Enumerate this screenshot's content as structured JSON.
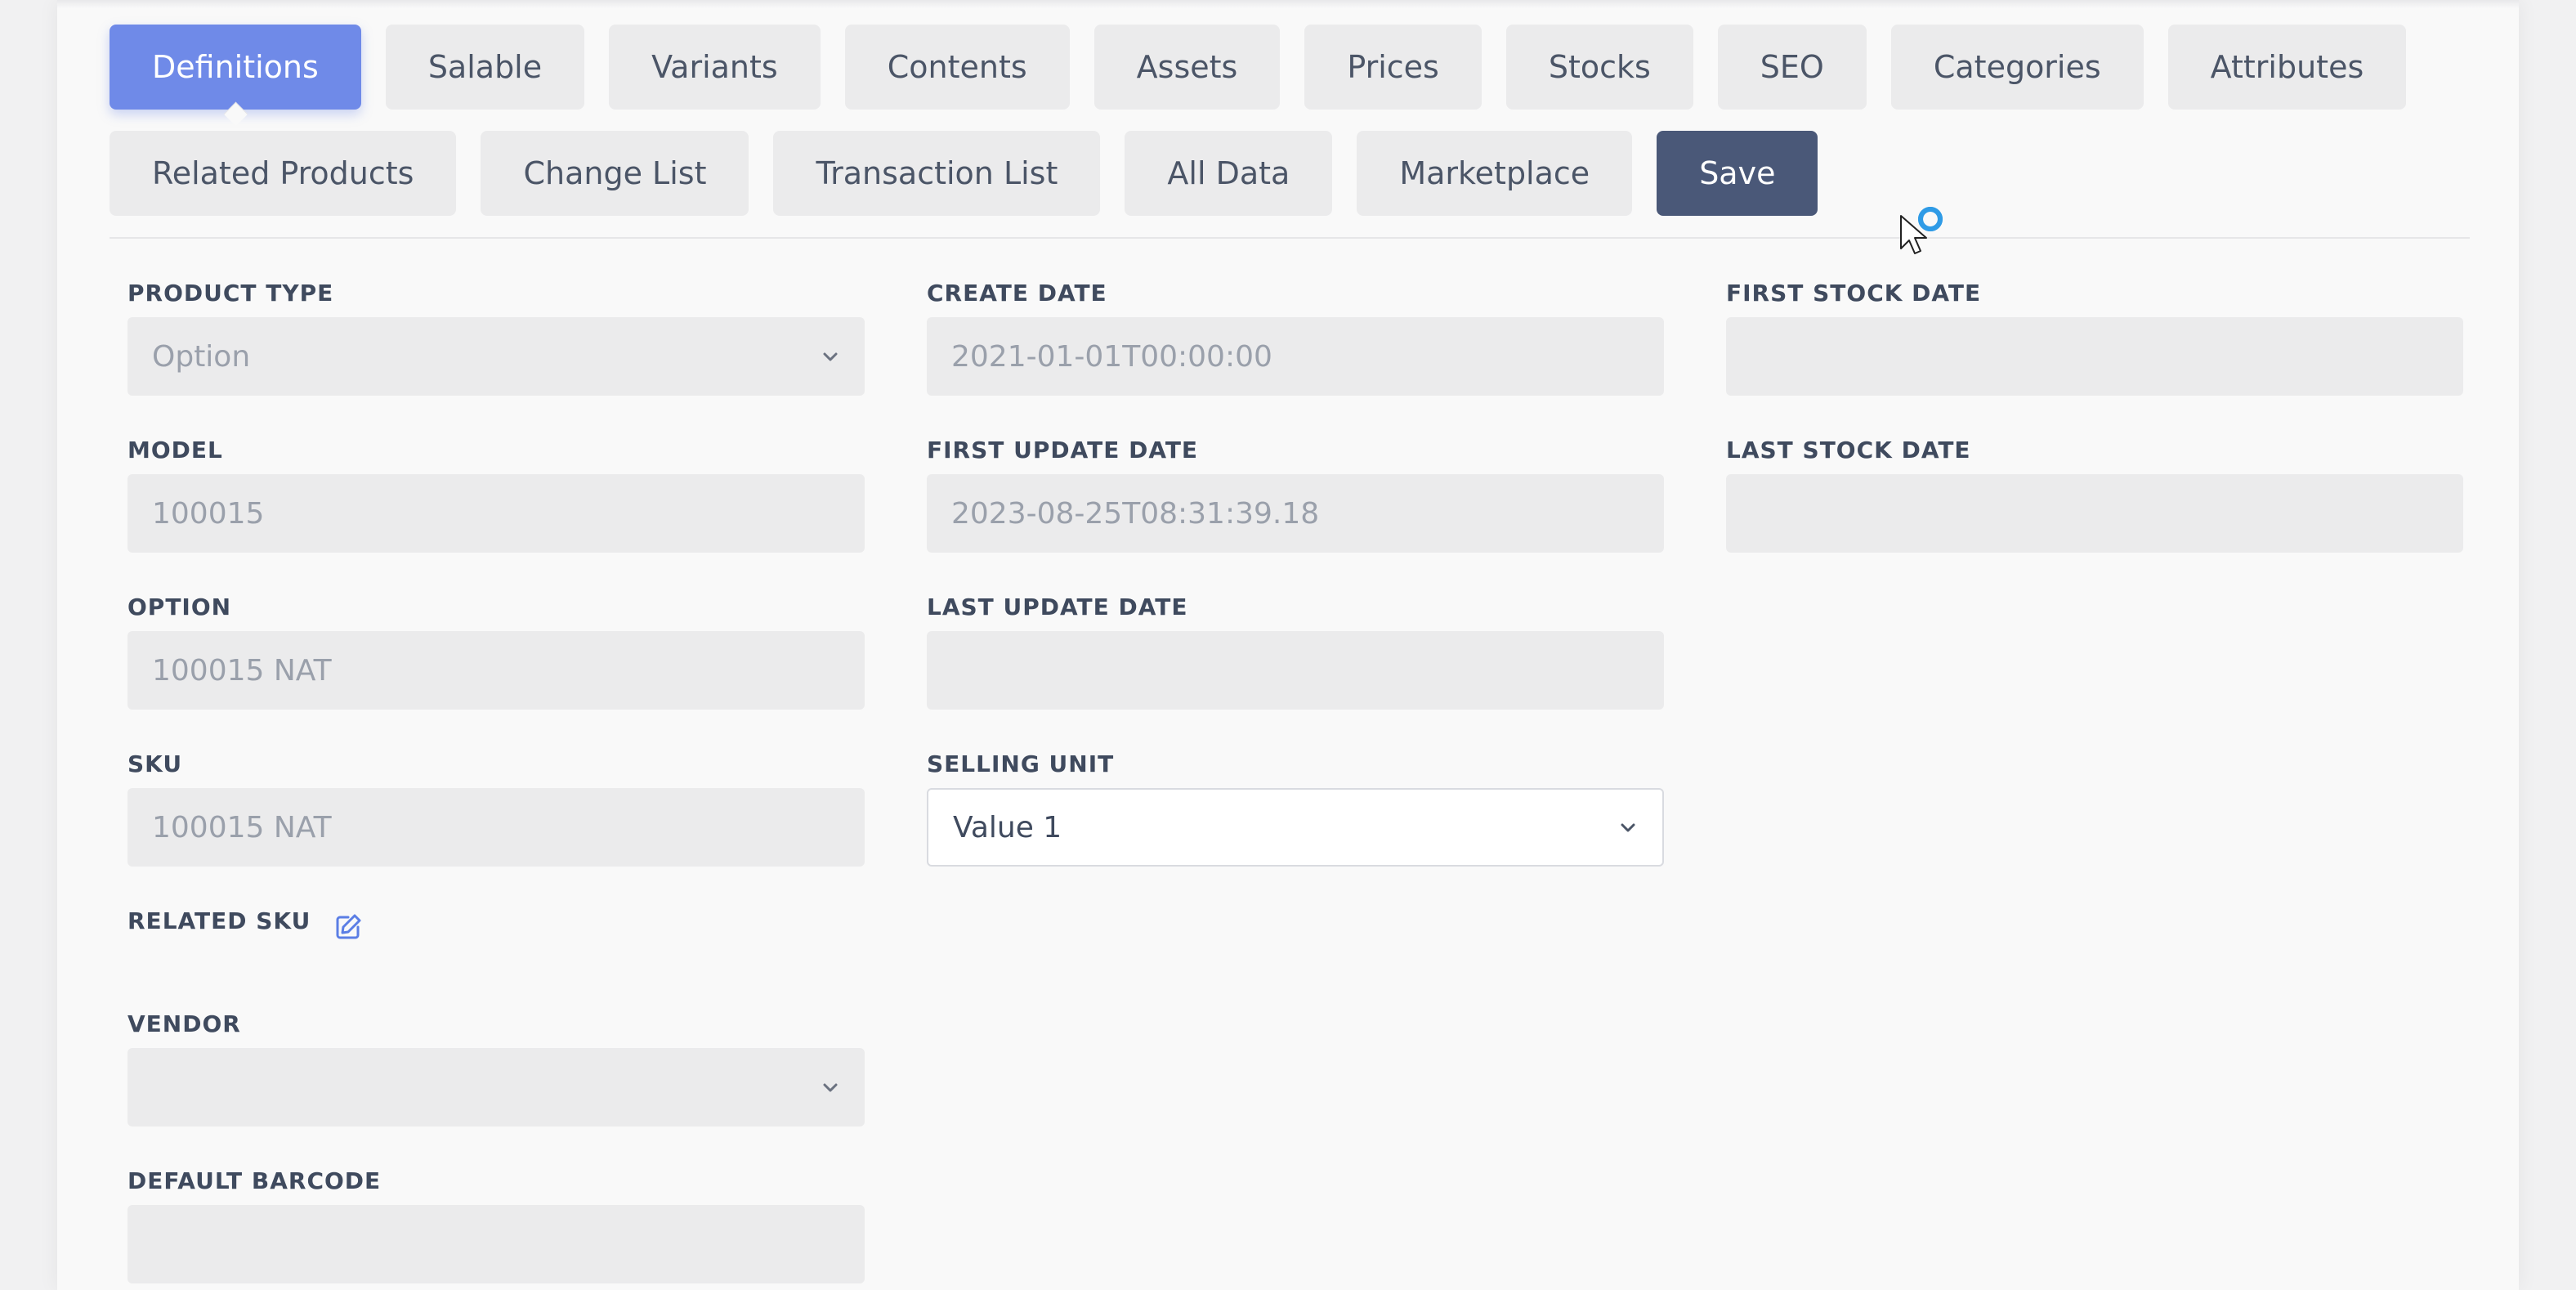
{
  "tabs_row1": [
    {
      "label": "Definitions",
      "active": true
    },
    {
      "label": "Salable"
    },
    {
      "label": "Variants"
    },
    {
      "label": "Contents"
    },
    {
      "label": "Assets"
    },
    {
      "label": "Prices"
    },
    {
      "label": "Stocks"
    },
    {
      "label": "SEO"
    },
    {
      "label": "Categories"
    },
    {
      "label": "Attributes"
    }
  ],
  "tabs_row2": [
    {
      "label": "Related Products"
    },
    {
      "label": "Change List"
    },
    {
      "label": "Transaction List"
    },
    {
      "label": "All Data"
    },
    {
      "label": "Marketplace"
    }
  ],
  "save_label": "Save",
  "fields": {
    "product_type": {
      "label": "PRODUCT TYPE",
      "value": "Option",
      "type": "select"
    },
    "model": {
      "label": "MODEL",
      "value": "100015"
    },
    "option": {
      "label": "OPTION",
      "value": "100015 NAT"
    },
    "sku": {
      "label": "SKU",
      "value": "100015 NAT"
    },
    "related_sku": {
      "label": "RELATED SKU"
    },
    "vendor": {
      "label": "VENDOR",
      "value": "",
      "type": "select"
    },
    "default_barcode": {
      "label": "DEFAULT BARCODE",
      "value": ""
    },
    "create_date": {
      "label": "CREATE DATE",
      "value": "2021-01-01T00:00:00"
    },
    "first_update_date": {
      "label": "FIRST UPDATE DATE",
      "value": "2023-08-25T08:31:39.18"
    },
    "last_update_date": {
      "label": "LAST UPDATE DATE",
      "value": ""
    },
    "selling_unit": {
      "label": "SELLING UNIT",
      "value": "Value 1",
      "type": "select"
    },
    "first_stock_date": {
      "label": "FIRST STOCK DATE",
      "value": ""
    },
    "last_stock_date": {
      "label": "LAST STOCK DATE",
      "value": ""
    }
  },
  "colors": {
    "active_tab": "#6f8ae8",
    "save_button": "#4a5878",
    "tab_bg": "#ebebec",
    "label_text": "#3f4a5e",
    "edit_icon": "#5b7ee5",
    "loading_ring": "#2f9be6"
  },
  "icons": {
    "chevron": "chevron-down-icon",
    "edit": "edit-icon",
    "cursor": "mouse-pointer-loading-icon"
  }
}
